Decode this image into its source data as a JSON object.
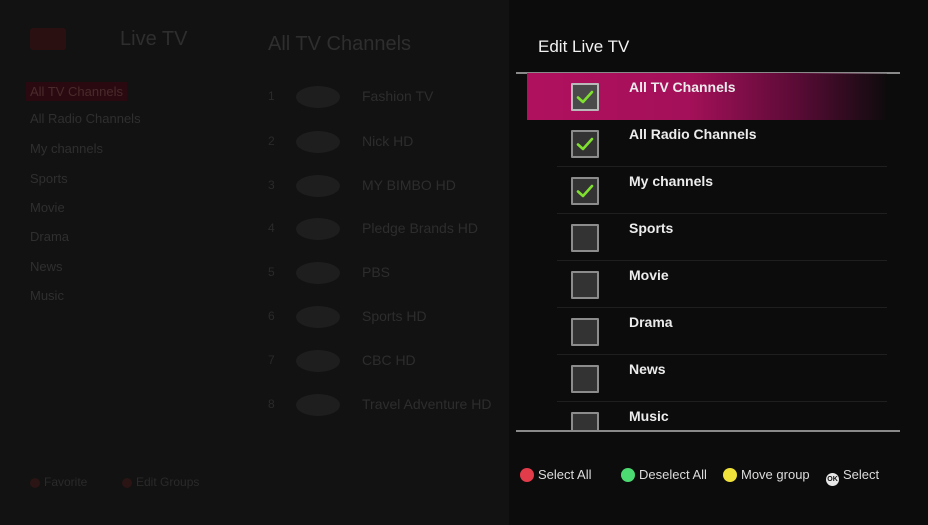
{
  "background": {
    "app_title": "Live TV",
    "section_title": "All TV Channels",
    "groups": [
      "All TV Channels",
      "All Radio Channels",
      "My channels",
      "Sports",
      "Movie",
      "Drama",
      "News",
      "Music"
    ],
    "channels": [
      {
        "num": "1",
        "name": "Fashion TV"
      },
      {
        "num": "2",
        "name": "Nick HD"
      },
      {
        "num": "3",
        "name": "MY BIMBO HD"
      },
      {
        "num": "4",
        "name": "Pledge Brands HD"
      },
      {
        "num": "5",
        "name": "PBS"
      },
      {
        "num": "6",
        "name": "Sports HD"
      },
      {
        "num": "7",
        "name": "CBC HD"
      },
      {
        "num": "8",
        "name": "Travel Adventure HD"
      }
    ],
    "hints": [
      "Favorite",
      "Edit Groups"
    ]
  },
  "panel": {
    "title": "Edit Live TV",
    "items": [
      {
        "label": "All TV Channels",
        "checked": true,
        "selected": true
      },
      {
        "label": "All Radio Channels",
        "checked": true,
        "selected": false
      },
      {
        "label": "My channels",
        "checked": true,
        "selected": false
      },
      {
        "label": "Sports",
        "checked": false,
        "selected": false
      },
      {
        "label": "Movie",
        "checked": false,
        "selected": false
      },
      {
        "label": "Drama",
        "checked": false,
        "selected": false
      },
      {
        "label": "News",
        "checked": false,
        "selected": false
      },
      {
        "label": "Music",
        "checked": false,
        "selected": false
      }
    ],
    "hints": {
      "red": "Select All",
      "green": "Deselect All",
      "yellow": "Move group",
      "ok_glyph": "OK",
      "ok": "Select"
    }
  },
  "colors": {
    "accent": "#b0115f",
    "check": "#7fe030",
    "red": "#e23b4a",
    "green": "#4cdb72",
    "yellow": "#f0e23a"
  }
}
